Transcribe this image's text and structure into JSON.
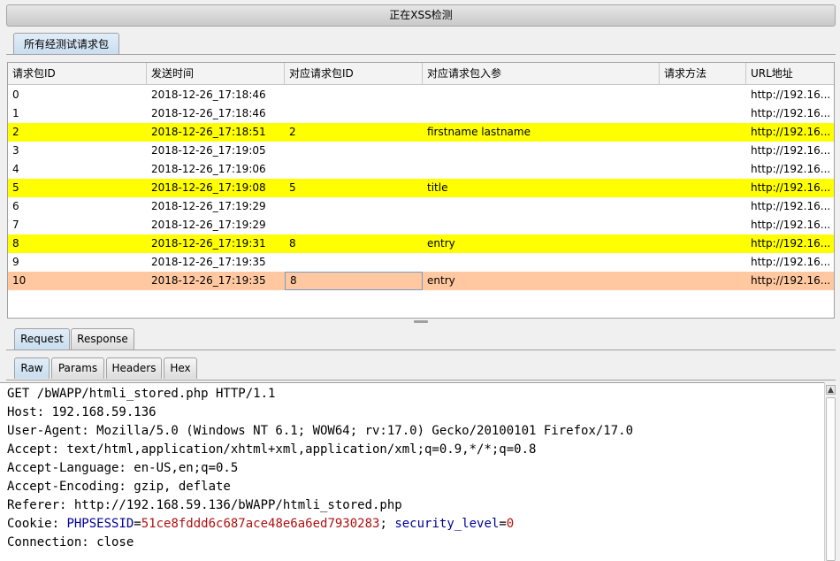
{
  "window": {
    "title": "正在XSS检测"
  },
  "top_tab": {
    "label": "所有经测试请求包"
  },
  "table": {
    "columns": [
      "请求包ID",
      "发送时间",
      "对应请求包ID",
      "对应请求包入参",
      "请求方法",
      "URL地址"
    ],
    "rows": [
      {
        "id": "0",
        "time": "2018-12-26_17:18:46",
        "ref_id": "",
        "params": "",
        "method": "",
        "url": "http://192.16...",
        "highlight": "none"
      },
      {
        "id": "1",
        "time": "2018-12-26_17:18:46",
        "ref_id": "",
        "params": "",
        "method": "",
        "url": "http://192.16...",
        "highlight": "none"
      },
      {
        "id": "2",
        "time": "2018-12-26_17:18:51",
        "ref_id": "2",
        "params": "firstname lastname",
        "method": "",
        "url": "http://192.16...",
        "highlight": "yellow"
      },
      {
        "id": "3",
        "time": "2018-12-26_17:19:05",
        "ref_id": "",
        "params": "",
        "method": "",
        "url": "http://192.16...",
        "highlight": "none"
      },
      {
        "id": "4",
        "time": "2018-12-26_17:19:06",
        "ref_id": "",
        "params": "",
        "method": "",
        "url": "http://192.16...",
        "highlight": "none"
      },
      {
        "id": "5",
        "time": "2018-12-26_17:19:08",
        "ref_id": "5",
        "params": "title",
        "method": "",
        "url": "http://192.16...",
        "highlight": "yellow"
      },
      {
        "id": "6",
        "time": "2018-12-26_17:19:29",
        "ref_id": "",
        "params": "",
        "method": "",
        "url": "http://192.16...",
        "highlight": "none"
      },
      {
        "id": "7",
        "time": "2018-12-26_17:19:29",
        "ref_id": "",
        "params": "",
        "method": "",
        "url": "http://192.16...",
        "highlight": "none"
      },
      {
        "id": "8",
        "time": "2018-12-26_17:19:31",
        "ref_id": "8",
        "params": "entry",
        "method": "",
        "url": "http://192.16...",
        "highlight": "yellow"
      },
      {
        "id": "9",
        "time": "2018-12-26_17:19:35",
        "ref_id": "",
        "params": "",
        "method": "",
        "url": "http://192.16...",
        "highlight": "none"
      },
      {
        "id": "10",
        "time": "2018-12-26_17:19:35",
        "ref_id": "8",
        "params": "entry",
        "method": "",
        "url": "http://192.16...",
        "highlight": "peach"
      }
    ]
  },
  "message_tabs": {
    "request": "Request",
    "response": "Response",
    "active": "request"
  },
  "view_tabs": {
    "raw": "Raw",
    "params": "Params",
    "headers": "Headers",
    "hex": "Hex",
    "active": "raw"
  },
  "request": {
    "request_line": "GET /bWAPP/htmli_stored.php HTTP/1.1",
    "host": "Host: 192.168.59.136",
    "user_agent": "User-Agent: Mozilla/5.0 (Windows NT 6.1; WOW64; rv:17.0) Gecko/20100101 Firefox/17.0",
    "accept": "Accept: text/html,application/xhtml+xml,application/xml;q=0.9,*/*;q=0.8",
    "accept_language": "Accept-Language: en-US,en;q=0.5",
    "accept_encoding": "Accept-Encoding: gzip, deflate",
    "referer": "Referer: http://192.168.59.136/bWAPP/htmli_stored.php",
    "cookie": {
      "prefix": "Cookie: ",
      "name1": "PHPSESSID",
      "eq1": "=",
      "value1": "51ce8fddd6c687ace48e6a6ed7930283",
      "sep": "; ",
      "name2": "security_level",
      "eq2": "=",
      "value2": "0"
    },
    "connection": "Connection: close"
  },
  "colors": {
    "highlight_yellow": "#ffff00",
    "highlight_peach": "#ffc8a0",
    "cookie_name": "#000099",
    "cookie_value": "#b01010"
  },
  "icons": {
    "scroll_up": "▲"
  }
}
